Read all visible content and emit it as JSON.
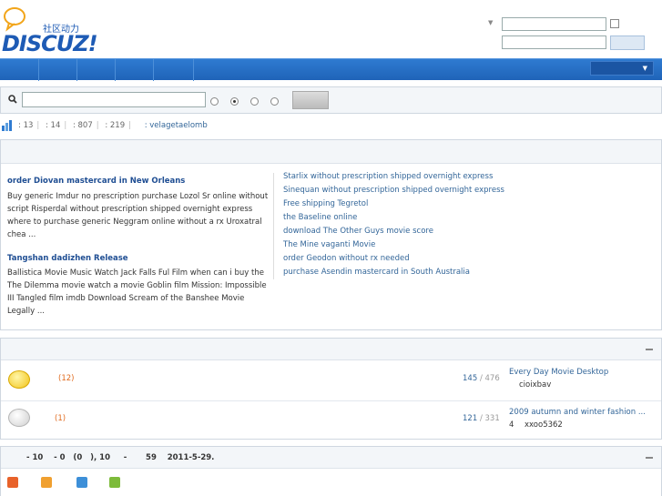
{
  "logo": {
    "text": "DISCUZ!",
    "subtitle": "社区动力"
  },
  "stats": {
    "a": ": 13",
    "b": ": 14",
    "c": ": 807",
    "d": ": 219",
    "user": ": velagetaelomb"
  },
  "left_posts": [
    {
      "title": "order Diovan mastercard in New Orleans",
      "body": [
        "Buy generic Imdur no prescription purchase Lozol Sr online without",
        "script Risperdal without prescription shipped overnight express",
        "where to purchase generic Neggram online without a rx Uroxatral",
        "chea ..."
      ]
    },
    {
      "title": "Tangshan dadizhen Release",
      "body": [
        "Ballistica Movie Music Watch Jack Falls Ful Film when can i buy the",
        "The Dilemma movie watch a movie Goblin film Mission: Impossible",
        "III Tangled film imdb Download Scream of the Banshee Movie",
        "Legally ..."
      ]
    }
  ],
  "right_links": [
    "Starlix without prescription shipped overnight express",
    "Sinequan without prescription shipped overnight express",
    "Free shipping Tegretol",
    "the Baseline online",
    "download The Other Guys movie score",
    "The Mine vaganti Movie",
    "order Geodon without rx needed",
    "purchase Asendin mastercard in South Australia"
  ],
  "forums": [
    {
      "count": "(12)",
      "threads": "145",
      "posts": "/ 476",
      "last_title": "Every Day Movie Desktop",
      "last_user": "cioixbav",
      "num": ""
    },
    {
      "count": "(1)",
      "threads": "121",
      "posts": "/ 331",
      "last_title": "2009 autumn and winter fashion ...",
      "last_user": "xxoo5362",
      "num": "4"
    }
  ],
  "online": {
    "text": "- 10    - 0   (0   ), 10     -       59    2011-5-29."
  },
  "colors": {
    "nav": "#2f7bd1",
    "accent": "#1e5bb5",
    "count": "#e06b1f"
  }
}
